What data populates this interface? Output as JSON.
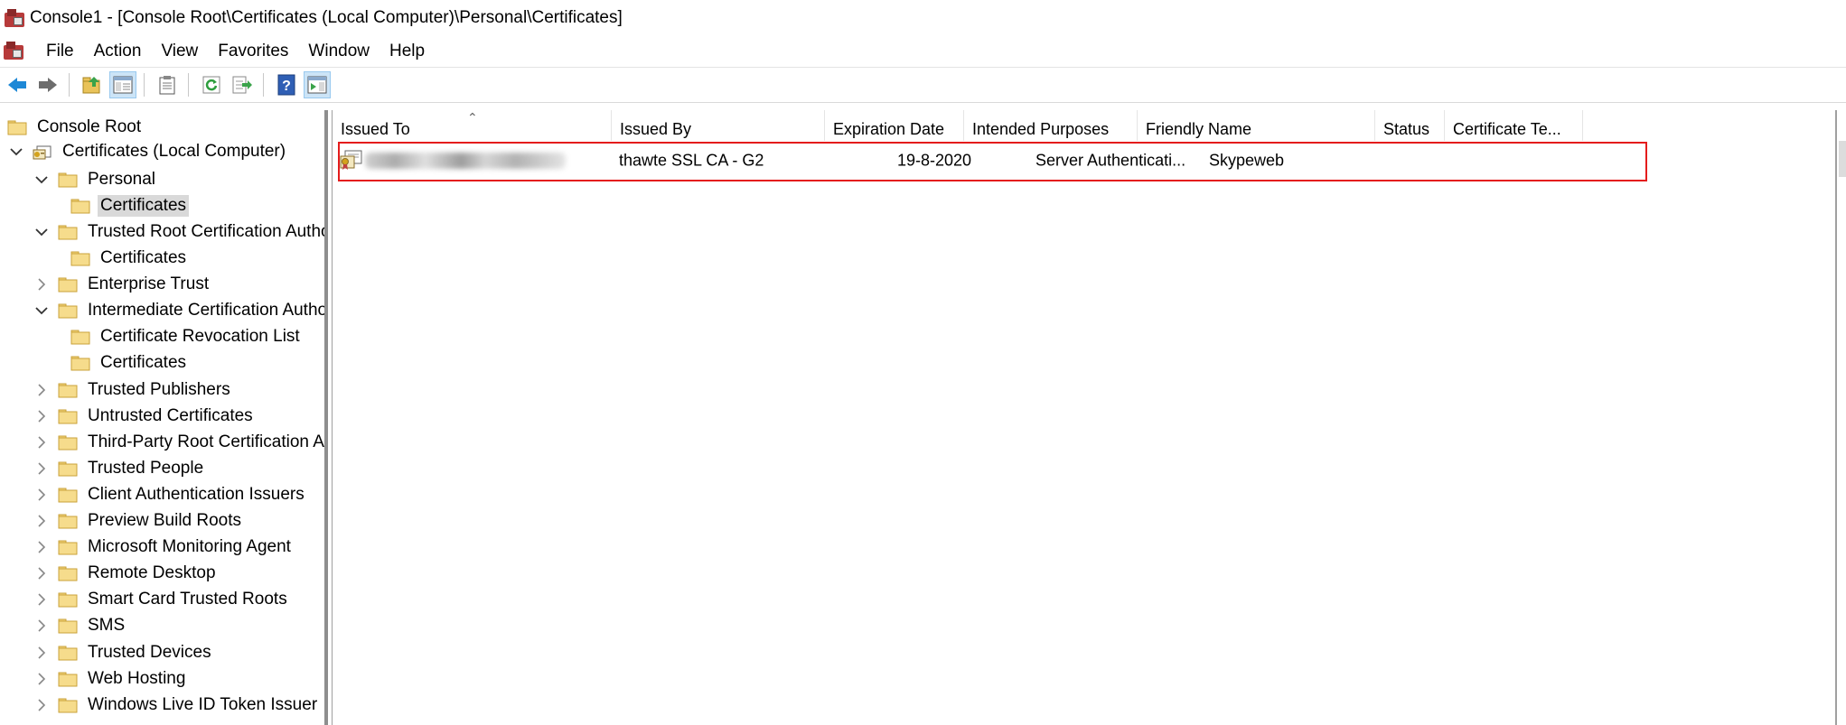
{
  "window": {
    "title": "Console1 - [Console Root\\Certificates (Local Computer)\\Personal\\Certificates]"
  },
  "menu": [
    "File",
    "Action",
    "View",
    "Favorites",
    "Window",
    "Help"
  ],
  "toolbar": {
    "buttons": [
      "back-icon",
      "forward-icon",
      "up-folder-icon",
      "show-hide-tree-icon",
      "properties-icon",
      "refresh-icon",
      "export-list-icon",
      "help-icon",
      "show-hide-action-pane-icon"
    ]
  },
  "tree": {
    "root": "Console Root",
    "computer": "Certificates (Local Computer)",
    "items": [
      {
        "label": "Personal",
        "expanded": true
      },
      {
        "label": "Certificates",
        "selected": true
      },
      {
        "label": "Trusted Root Certification Autho",
        "expanded": true
      },
      {
        "label": "Certificates"
      },
      {
        "label": "Enterprise Trust",
        "expanded": false
      },
      {
        "label": "Intermediate Certification Autho",
        "expanded": true
      },
      {
        "label": "Certificate Revocation List"
      },
      {
        "label": "Certificates"
      },
      {
        "label": "Trusted Publishers",
        "expanded": false
      },
      {
        "label": "Untrusted Certificates",
        "expanded": false
      },
      {
        "label": "Third-Party Root Certification Au",
        "expanded": false
      },
      {
        "label": "Trusted People",
        "expanded": false
      },
      {
        "label": "Client Authentication Issuers",
        "expanded": false
      },
      {
        "label": "Preview Build Roots",
        "expanded": false
      },
      {
        "label": "Microsoft Monitoring Agent",
        "expanded": false
      },
      {
        "label": "Remote Desktop",
        "expanded": false
      },
      {
        "label": "Smart Card Trusted Roots",
        "expanded": false
      },
      {
        "label": "SMS",
        "expanded": false
      },
      {
        "label": "Trusted Devices",
        "expanded": false
      },
      {
        "label": "Web Hosting",
        "expanded": false
      },
      {
        "label": "Windows Live ID Token Issuer",
        "expanded": false
      }
    ]
  },
  "list": {
    "columns": [
      "Issued To",
      "Issued By",
      "Expiration Date",
      "Intended Purposes",
      "Friendly Name",
      "Status",
      "Certificate Te..."
    ],
    "sort_column": "Issued To",
    "rows": [
      {
        "issued_to": "",
        "issued_by": "thawte SSL CA - G2",
        "expiration_date": "19-8-2020",
        "intended_purposes": "Server Authenticati...",
        "friendly_name": "Skypeweb",
        "status": "",
        "certificate_template": ""
      }
    ]
  },
  "colors": {
    "selection_outline": "#e41c1c",
    "folder_yellow": "#f2d47a",
    "pressed_button": "#cce4f7"
  }
}
